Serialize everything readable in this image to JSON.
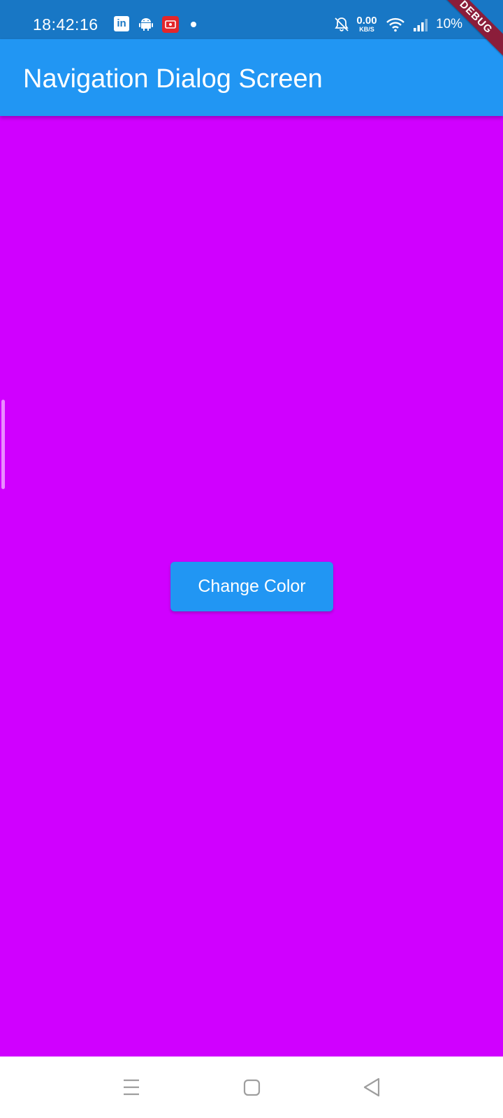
{
  "status_bar": {
    "time": "18:42:16",
    "linkedin_glyph": "in",
    "net_speed_value": "0.00",
    "net_speed_unit": "KB/S",
    "battery": "10%",
    "icons": [
      "linkedin-icon",
      "android-icon",
      "screen-record-icon",
      "notification-dot-icon",
      "bell-off-icon",
      "wifi-icon",
      "signal-icon"
    ]
  },
  "debug_banner": "DEBUG",
  "app_bar": {
    "title": "Navigation Dialog Screen"
  },
  "main": {
    "background_color": "#d000ff",
    "button_label": "Change Color"
  },
  "nav_bar": {
    "icons": [
      "menu-icon",
      "home-icon",
      "back-icon"
    ]
  },
  "colors": {
    "app_bar": "#2196f3",
    "status_bar": "#1877c5",
    "button": "#2196f3",
    "debug_banner": "#8b1d3a"
  }
}
